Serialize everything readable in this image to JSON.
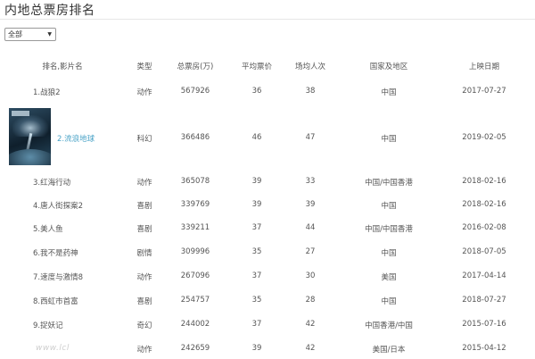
{
  "page": {
    "title": "内地总票房排名"
  },
  "filter": {
    "selected": "全部"
  },
  "table": {
    "headers": [
      "排名,影片名",
      "类型",
      "总票房(万)",
      "平均票价",
      "场均人次",
      "国家及地区",
      "上映日期"
    ],
    "rows": [
      {
        "name": "1.战狼2",
        "type": "动作",
        "gross": "567926",
        "avg_price": "36",
        "per_show": "38",
        "country": "中国",
        "date": "2017-07-27",
        "featured": false
      },
      {
        "name": "2.流浪地球",
        "type": "科幻",
        "gross": "366486",
        "avg_price": "46",
        "per_show": "47",
        "country": "中国",
        "date": "2019-02-05",
        "featured": true
      },
      {
        "name": "3.红海行动",
        "type": "动作",
        "gross": "365078",
        "avg_price": "39",
        "per_show": "33",
        "country": "中国/中国香港",
        "date": "2018-02-16",
        "featured": false
      },
      {
        "name": "4.唐人街探案2",
        "type": "喜剧",
        "gross": "339769",
        "avg_price": "39",
        "per_show": "39",
        "country": "中国",
        "date": "2018-02-16",
        "featured": false
      },
      {
        "name": "5.美人鱼",
        "type": "喜剧",
        "gross": "339211",
        "avg_price": "37",
        "per_show": "44",
        "country": "中国/中国香港",
        "date": "2016-02-08",
        "featured": false
      },
      {
        "name": "6.我不是药神",
        "type": "剧情",
        "gross": "309996",
        "avg_price": "35",
        "per_show": "27",
        "country": "中国",
        "date": "2018-07-05",
        "featured": false
      },
      {
        "name": "7.速度与激情8",
        "type": "动作",
        "gross": "267096",
        "avg_price": "37",
        "per_show": "30",
        "country": "美国",
        "date": "2017-04-14",
        "featured": false
      },
      {
        "name": "8.西虹市首富",
        "type": "喜剧",
        "gross": "254757",
        "avg_price": "35",
        "per_show": "28",
        "country": "中国",
        "date": "2018-07-27",
        "featured": false
      },
      {
        "name": "9.捉妖记",
        "type": "奇幻",
        "gross": "244002",
        "avg_price": "37",
        "per_show": "42",
        "country": "中国香港/中国",
        "date": "2015-07-16",
        "featured": false
      },
      {
        "name": "",
        "type": "动作",
        "gross": "242659",
        "avg_price": "39",
        "per_show": "42",
        "country": "美国/日本",
        "date": "2015-04-12",
        "featured": false
      }
    ]
  },
  "watermark": {
    "text": "www.lcl"
  }
}
